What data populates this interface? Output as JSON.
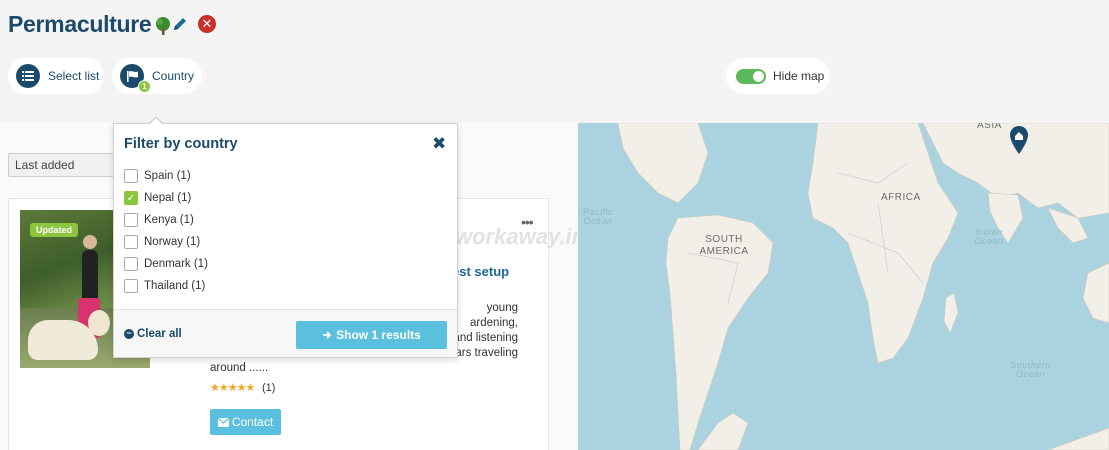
{
  "header": {
    "title": "Permaculture",
    "select_list_label": "Select list",
    "country_label": "Country",
    "country_badge": "1",
    "hide_map_label": "Hide map"
  },
  "sort": {
    "selected": "Last added"
  },
  "card": {
    "updated_badge": "Updated",
    "title_fragment": "est setup",
    "watermark": "workaway.info",
    "desc_lines": [
      "young",
      "ardening,",
      "and listening",
      "ars traveling"
    ],
    "desc_last": "around ......",
    "stars": "★★★★★",
    "review_count": "(1)",
    "contact_label": "Contact"
  },
  "filter_popup": {
    "title": "Filter by country",
    "options": [
      {
        "label": "Spain (1)",
        "checked": false
      },
      {
        "label": "Nepal (1)",
        "checked": true
      },
      {
        "label": "Kenya (1)",
        "checked": false
      },
      {
        "label": "Norway (1)",
        "checked": false
      },
      {
        "label": "Denmark (1)",
        "checked": false
      },
      {
        "label": "Thailand (1)",
        "checked": false
      }
    ],
    "clear_all": "Clear all",
    "show_button": "Show 1 results"
  },
  "map": {
    "labels": {
      "asia": "ASIA",
      "africa": "AFRICA",
      "south_america": "SOUTH AMERICA",
      "pacific_ocean": "Pacific Ocean",
      "indian_ocean": "Indian Ocean",
      "southern_ocean": "Southern Ocean"
    }
  },
  "colors": {
    "primary": "#1b4a6b",
    "accent_green": "#8cc63f",
    "button_blue": "#5bc0de",
    "danger": "#c9302c",
    "ocean": "#aad3df",
    "land": "#f2efe9"
  }
}
